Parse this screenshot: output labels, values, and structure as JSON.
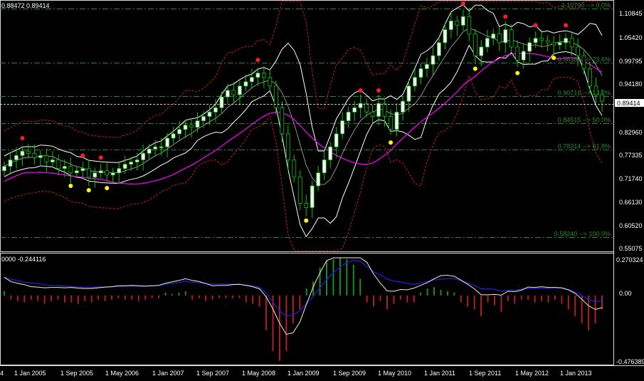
{
  "header": {
    "price_info": "0.88472 0.89414",
    "indicator_info": "0000 -0.244116"
  },
  "price_axis": {
    "ticks": [
      "1.10845",
      "1.05420",
      "0.99795",
      "0.94180",
      "0.88645",
      "0.82960",
      "0.77335",
      "0.71740",
      "0.66130",
      "0.60520",
      "0.55075"
    ],
    "current": "0.89414"
  },
  "osc_axis": {
    "ticks": [
      "0.270324",
      "0.00",
      "-0.476389"
    ]
  },
  "time_axis": {
    "labels": [
      "4",
      "1 Jan 2005",
      "1 Sep 2005",
      "1 May 2006",
      "1 Jan 2007",
      "1 Sep 2007",
      "1 May 2008",
      "1 Jan 2009",
      "1 Sep 2009",
      "1 May 2010",
      "1 Jan 2011",
      "1 Sep 2011",
      "1 May 2012",
      "1 Jan 2013"
    ]
  },
  "fibo": {
    "levels": [
      {
        "price": 1.1079,
        "label": "1.10790 --> 0.0%"
      },
      {
        "price": 0.98389,
        "label": "0.98389 --> 23.6%"
      },
      {
        "price": 0.90716,
        "label": "0.90716 --> 38.2%"
      },
      {
        "price": 0.84515,
        "label": "0.84515 --> 50.0%"
      },
      {
        "price": 0.78314,
        "label": "0.78314 --> 61.8%"
      },
      {
        "price": 0.5824,
        "label": "0.58240 --> 100.0%"
      }
    ]
  },
  "colors": {
    "background": "#000000",
    "bull_candle": "#ffffff",
    "bear_candle": "#000000",
    "candle_wick": "#00c800",
    "fib_line": "#228b22",
    "bands_outer": "#c81e1e",
    "bands_inner": "#ffffff",
    "ma_line": "#ff00ff",
    "signal_red": "#ff1e1e",
    "signal_yellow": "#ffff00",
    "hist_positive": "#1e8c1e",
    "hist_negative": "#b41e1e",
    "osc_fast": "#f0f0c8",
    "osc_slow": "#1e1ec8"
  },
  "chart_data": {
    "type": "candlestick",
    "x_start": "2004-08",
    "x_end": "2013-06",
    "price_range": [
      0.55075,
      1.125
    ],
    "osc_range": [
      -0.476389,
      0.270324
    ],
    "close_series": [
      0.745,
      0.76,
      0.77,
      0.78,
      0.775,
      0.765,
      0.77,
      0.755,
      0.76,
      0.74,
      0.745,
      0.73,
      0.735,
      0.74,
      0.72,
      0.73,
      0.735,
      0.725,
      0.73,
      0.74,
      0.75,
      0.755,
      0.76,
      0.775,
      0.785,
      0.79,
      0.79,
      0.81,
      0.82,
      0.83,
      0.84,
      0.835,
      0.85,
      0.86,
      0.87,
      0.88,
      0.905,
      0.92,
      0.91,
      0.93,
      0.94,
      0.95,
      0.96,
      0.95,
      0.93,
      0.88,
      0.82,
      0.76,
      0.72,
      0.66,
      0.65,
      0.7,
      0.73,
      0.76,
      0.79,
      0.82,
      0.85,
      0.87,
      0.88,
      0.89,
      0.87,
      0.86,
      0.89,
      0.86,
      0.83,
      0.87,
      0.895,
      0.93,
      0.95,
      0.97,
      0.98,
      1.0,
      1.03,
      1.06,
      1.08,
      1.07,
      1.09,
      1.05,
      1.0,
      1.02,
      1.04,
      1.05,
      1.03,
      1.06,
      1.02,
      0.99,
      1.01,
      1.03,
      1.04,
      1.035,
      1.03,
      1.025,
      1.03,
      1.04,
      1.02,
      1.0,
      0.97,
      0.93,
      0.91,
      0.895
    ],
    "histogram": [
      0.03,
      -0.03,
      -0.04,
      -0.05,
      -0.03,
      -0.04,
      -0.06,
      -0.04,
      -0.03,
      -0.05,
      -0.05,
      -0.06,
      -0.04,
      -0.05,
      -0.03,
      -0.04,
      -0.03,
      -0.02,
      -0.03,
      -0.03,
      -0.04,
      -0.03,
      -0.02,
      -0.02,
      0.02,
      0.01,
      0.02,
      0.03,
      -0.03,
      -0.02,
      -0.04,
      -0.03,
      -0.02,
      -0.02,
      -0.02,
      -0.02,
      -0.05,
      -0.06,
      -0.08,
      -0.25,
      -0.4,
      -0.47,
      -0.4,
      -0.2,
      -0.1,
      0.05,
      0.1,
      0.2,
      0.25,
      0.26,
      0.27,
      0.26,
      0.22,
      0.12,
      -0.05,
      -0.08,
      -0.04,
      -0.1,
      -0.06,
      -0.03,
      -0.05,
      -0.05,
      0.02,
      0.05,
      0.06,
      0.04,
      0.03,
      0.02,
      -0.05,
      -0.08,
      -0.1,
      -0.15,
      -0.05,
      -0.07,
      -0.12,
      -0.04,
      -0.06,
      -0.03,
      -0.03,
      -0.05,
      -0.04,
      -0.05,
      -0.03,
      -0.06,
      -0.1,
      -0.15,
      -0.2,
      -0.25,
      -0.2,
      -0.1
    ]
  }
}
